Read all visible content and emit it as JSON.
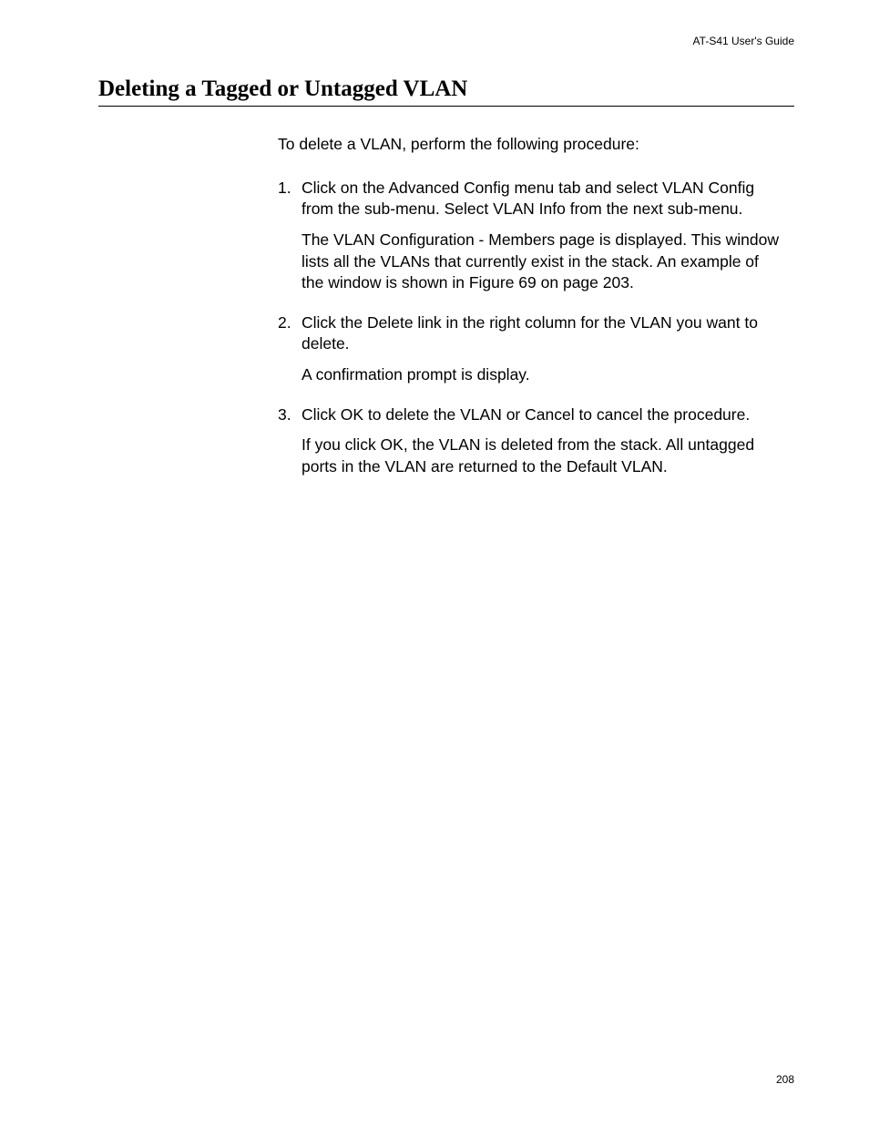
{
  "header": {
    "guide_name": "AT-S41 User's Guide"
  },
  "section": {
    "title": "Deleting a Tagged or Untagged VLAN",
    "intro": "To delete a VLAN, perform the following procedure:"
  },
  "steps": [
    {
      "number": "1.",
      "paragraphs": [
        "Click on the Advanced Config menu tab and select VLAN Config from the sub-menu. Select VLAN Info from the next sub-menu.",
        "The VLAN Configuration - Members page is displayed. This window lists all the VLANs that currently exist in the stack. An example of the window is shown in Figure 69 on page 203."
      ]
    },
    {
      "number": "2.",
      "paragraphs": [
        "Click the Delete link in the right column for the VLAN you want to delete.",
        "A confirmation prompt is display."
      ]
    },
    {
      "number": "3.",
      "paragraphs": [
        "Click OK to delete the VLAN or Cancel to cancel the procedure.",
        "If you click OK, the VLAN is deleted from the stack. All untagged ports in the VLAN are returned to the Default VLAN."
      ]
    }
  ],
  "footer": {
    "page_number": "208"
  }
}
